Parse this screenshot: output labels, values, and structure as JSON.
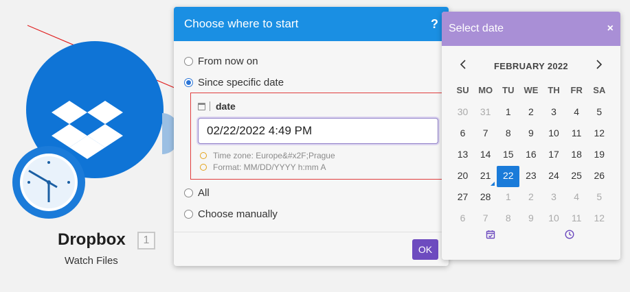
{
  "canvas": {
    "module_title": "Dropbox",
    "module_count": "1",
    "module_subtitle": "Watch Files",
    "module_color": "#0f74d6"
  },
  "dialog": {
    "title": "Choose where to start",
    "help": "?",
    "options_top": [
      {
        "label": "From now on",
        "checked": false
      },
      {
        "label": "Since specific date",
        "checked": true
      }
    ],
    "date_field": {
      "label": "date",
      "value": "02/22/2022 4:49 PM",
      "timezone_hint": "Time zone: Europe&#x2F;Prague",
      "format_hint": "Format: MM/DD/YYYY h:mm A"
    },
    "options_bottom": [
      {
        "label": "All",
        "checked": false
      },
      {
        "label": "Choose manually",
        "checked": false
      }
    ],
    "ok_label": "OK",
    "header_color": "#1a8fe3",
    "ok_color": "#6d4bbf"
  },
  "picker": {
    "title": "Select date",
    "close": "×",
    "month": "FEBRUARY 2022",
    "prev": "‹",
    "next": "›",
    "weekdays": [
      "SU",
      "MO",
      "TU",
      "WE",
      "TH",
      "FR",
      "SA"
    ],
    "weeks": [
      [
        [
          "30",
          "off"
        ],
        [
          "31",
          "off"
        ],
        [
          "1",
          ""
        ],
        [
          "2",
          ""
        ],
        [
          "3",
          ""
        ],
        [
          "4",
          ""
        ],
        [
          "5",
          ""
        ]
      ],
      [
        [
          "6",
          ""
        ],
        [
          "7",
          ""
        ],
        [
          "8",
          ""
        ],
        [
          "9",
          ""
        ],
        [
          "10",
          ""
        ],
        [
          "11",
          ""
        ],
        [
          "12",
          ""
        ]
      ],
      [
        [
          "13",
          ""
        ],
        [
          "14",
          ""
        ],
        [
          "15",
          ""
        ],
        [
          "16",
          ""
        ],
        [
          "17",
          ""
        ],
        [
          "18",
          ""
        ],
        [
          "19",
          ""
        ]
      ],
      [
        [
          "20",
          ""
        ],
        [
          "21",
          "today"
        ],
        [
          "22",
          "sel"
        ],
        [
          "23",
          ""
        ],
        [
          "24",
          ""
        ],
        [
          "25",
          ""
        ],
        [
          "26",
          ""
        ]
      ],
      [
        [
          "27",
          ""
        ],
        [
          "28",
          ""
        ],
        [
          "1",
          "off"
        ],
        [
          "2",
          "off"
        ],
        [
          "3",
          "off"
        ],
        [
          "4",
          "off"
        ],
        [
          "5",
          "off"
        ]
      ],
      [
        [
          "6",
          "off"
        ],
        [
          "7",
          "off"
        ],
        [
          "8",
          "off"
        ],
        [
          "9",
          "off"
        ],
        [
          "10",
          "off"
        ],
        [
          "11",
          "off"
        ],
        [
          "12",
          "off"
        ]
      ]
    ],
    "footer_icons": [
      "calendar-check-icon",
      "clock-icon"
    ],
    "header_color": "#a98fd6",
    "selected_color": "#1a7bd9"
  }
}
